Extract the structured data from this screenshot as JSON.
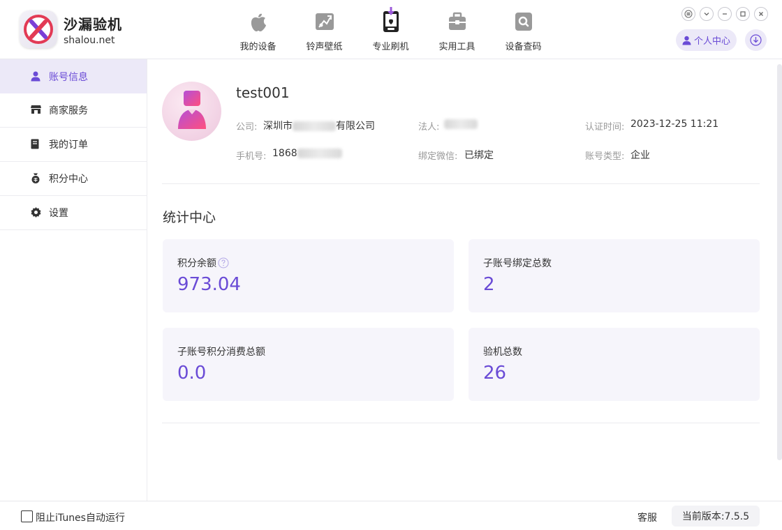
{
  "app": {
    "name": "沙漏验机",
    "url": "shalou.net"
  },
  "nav": [
    {
      "label": "我的设备",
      "icon": "apple-icon"
    },
    {
      "label": "铃声壁纸",
      "icon": "wallpaper-icon"
    },
    {
      "label": "专业刷机",
      "icon": "flash-icon"
    },
    {
      "label": "实用工具",
      "icon": "toolbox-icon"
    },
    {
      "label": "设备查码",
      "icon": "search-device-icon"
    }
  ],
  "header": {
    "user_center": "个人中心"
  },
  "sidebar": {
    "items": [
      {
        "label": "账号信息",
        "icon": "user-icon",
        "active": true
      },
      {
        "label": "商家服务",
        "icon": "store-icon",
        "active": false
      },
      {
        "label": "我的订单",
        "icon": "order-icon",
        "active": false
      },
      {
        "label": "积分中心",
        "icon": "points-icon",
        "active": false
      },
      {
        "label": "设置",
        "icon": "gear-icon",
        "active": false
      }
    ]
  },
  "profile": {
    "username": "test001",
    "company_label": "公司:",
    "company_prefix": "深圳市",
    "company_suffix": "有限公司",
    "legal_label": "法人:",
    "cert_time_label": "认证时间:",
    "cert_time": "2023-12-25 11:21",
    "phone_label": "手机号:",
    "phone_prefix": "1868",
    "wechat_label": "绑定微信:",
    "wechat_value": "已绑定",
    "account_type_label": "账号类型:",
    "account_type": "企业"
  },
  "stats": {
    "title": "统计中心",
    "cards": [
      {
        "label": "积分余额",
        "value": "973.04",
        "help": true
      },
      {
        "label": "子账号绑定总数",
        "value": "2"
      },
      {
        "label": "子账号积分消费总额",
        "value": "0.0"
      },
      {
        "label": "验机总数",
        "value": "26"
      }
    ]
  },
  "statusbar": {
    "block_itunes_label": "阻止iTunes自动运行",
    "block_itunes_checked": false,
    "support_label": "客服",
    "version_label": "当前版本:7.5.5"
  },
  "colors": {
    "accent": "#6a4bd6",
    "accent_bg": "#ece9f8",
    "card_bg": "#f6f5fb"
  }
}
